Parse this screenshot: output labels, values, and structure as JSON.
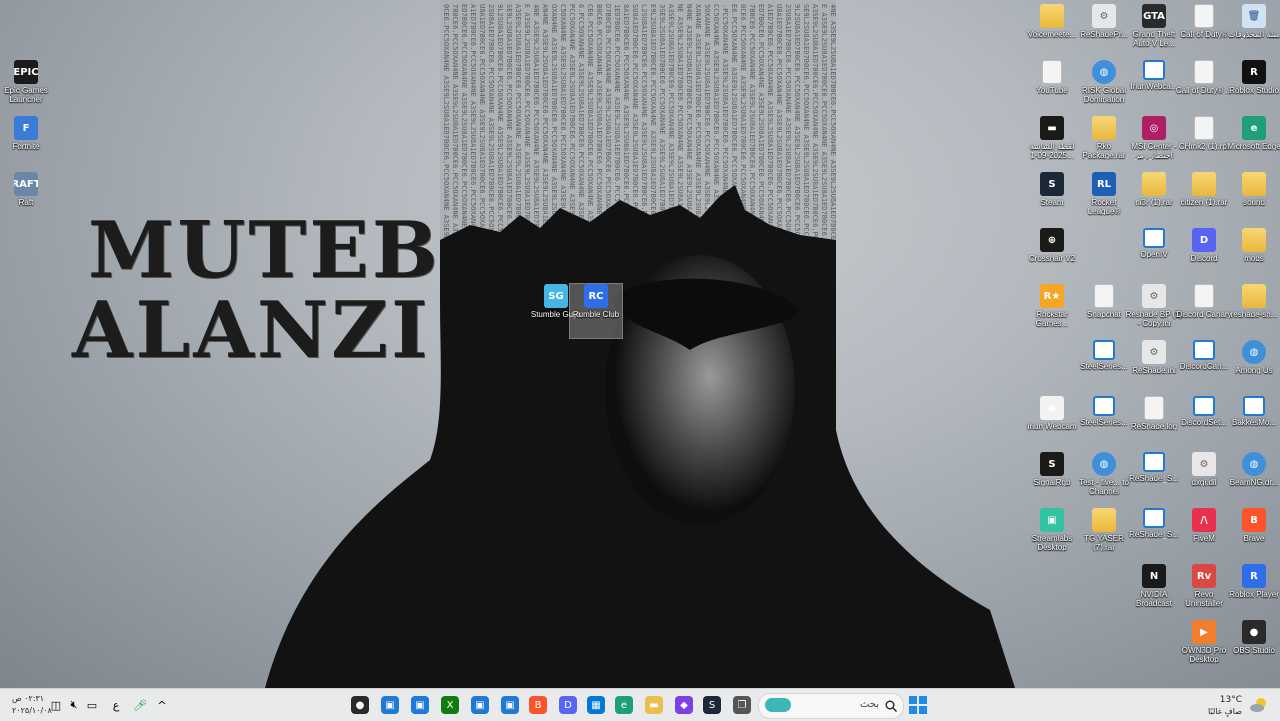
{
  "wallpaper": {
    "line1": "MUTEB",
    "line2": "ALANZI"
  },
  "desktop_icons": [
    {
      "label": "Voicemeete...",
      "kind": "folder",
      "color": "#e9bf4f"
    },
    {
      "label": "ReShadePr...",
      "kind": "gear",
      "color": "#8a8f96"
    },
    {
      "label": "Grand Theft Auto V Le...",
      "kind": "app",
      "color": "#2b2b2b",
      "text": "GTA"
    },
    {
      "label": "Call of Duty®",
      "kind": "file",
      "color": "#ffffff"
    },
    {
      "label": "سلة المحذوفات",
      "kind": "bin",
      "color": "#cfe3f5"
    },
    {
      "label": "Epic Games Launcher",
      "kind": "app",
      "color": "#1b1b1b",
      "text": "EPIC"
    },
    {
      "label": "YouTube",
      "kind": "file",
      "color": "#ffffff"
    },
    {
      "label": "RISK Global Domination",
      "kind": "globe",
      "color": "#3f8fd9"
    },
    {
      "label": "IriunWebca...",
      "kind": "box",
      "color": "#1f7ad6"
    },
    {
      "label": "Call of Duty® ...",
      "kind": "file",
      "color": "#ffffff"
    },
    {
      "label": "Roblox Studio",
      "kind": "app",
      "color": "#111111",
      "text": "R"
    },
    {
      "label": "Fortnite",
      "kind": "app",
      "color": "#3a7bd5",
      "text": "F"
    },
    {
      "label": "لقطة الشاشة 2025-09-1...",
      "kind": "app",
      "color": "#1a1a1a",
      "text": "▬"
    },
    {
      "label": "Rko Package.rar",
      "kind": "folder",
      "color": "#e9bf4f"
    },
    {
      "label": "MSI Center - اختصار رمز",
      "kind": "app",
      "color": "#b01e63",
      "text": "◎"
    },
    {
      "label": "CHmk2 (1).rpf",
      "kind": "file",
      "color": "#ffffff"
    },
    {
      "label": "Microsoft Edge",
      "kind": "app",
      "color": "#1f9e7a",
      "text": "e"
    },
    {
      "label": "Raft",
      "kind": "app",
      "color": "#6a87a8",
      "text": "RAFT"
    },
    {
      "label": "Steam",
      "kind": "app",
      "color": "#1b2838",
      "text": "S"
    },
    {
      "label": "Rocket League®",
      "kind": "app",
      "color": "#1d5fb4",
      "text": "RL"
    },
    {
      "label": "ni3r (1).rar",
      "kind": "folder",
      "color": "#e9bf4f"
    },
    {
      "label": "citizen (1).rar",
      "kind": "folder",
      "color": "#e9bf4f"
    },
    {
      "label": "sound",
      "kind": "folder",
      "color": "#e9bf4f"
    },
    {
      "label": "Crosshair V2",
      "kind": "app",
      "color": "#1a1a1a",
      "text": "⊕"
    },
    {
      "label": "OpenIV",
      "kind": "box",
      "color": "#1f7ad6"
    },
    {
      "label": "Discord",
      "kind": "app",
      "color": "#5865f2",
      "text": "D"
    },
    {
      "label": "mods",
      "kind": "folder",
      "color": "#e9bf4f"
    },
    {
      "label": "Rockstar Games...",
      "kind": "app",
      "color": "#f5a623",
      "text": "R★"
    },
    {
      "label": "Snapchat",
      "kind": "file",
      "color": "#ffffff"
    },
    {
      "label": "Reshade BP (1) - Copy.ini",
      "kind": "gear",
      "color": "#8a8f96"
    },
    {
      "label": "Discord Canary",
      "kind": "file",
      "color": "#ffffff"
    },
    {
      "label": "reshade-sh...",
      "kind": "folder",
      "color": "#e9bf4f"
    },
    {
      "label": "SteelSeries...",
      "kind": "box",
      "color": "#1f7ad6"
    },
    {
      "label": "ReShade.ini",
      "kind": "gear",
      "color": "#8a8f96"
    },
    {
      "label": "DiscordCan...",
      "kind": "box",
      "color": "#1f7ad6"
    },
    {
      "label": "Among Us",
      "kind": "globe",
      "color": "#3f8fd9"
    },
    {
      "label": "Iriun Webcam",
      "kind": "app",
      "color": "#f2f2f2",
      "text": "◉"
    },
    {
      "label": "SteelSeries...",
      "kind": "box",
      "color": "#1f7ad6"
    },
    {
      "label": "ReShade.log",
      "kind": "file",
      "color": "#ffffff"
    },
    {
      "label": "DiscordSet...",
      "kind": "box",
      "color": "#1f7ad6"
    },
    {
      "label": "BakkesMo...",
      "kind": "box",
      "color": "#1f7ad6"
    },
    {
      "label": "SignalRgb",
      "kind": "app",
      "color": "#1a1a1a",
      "text": "S"
    },
    {
      "label": "Test - five... to Channel",
      "kind": "globe",
      "color": "#3f8fd9"
    },
    {
      "label": "ReShade_S...",
      "kind": "box",
      "color": "#1f7ad6"
    },
    {
      "label": "dxgi.dll",
      "kind": "gear",
      "color": "#8a8f96"
    },
    {
      "label": "BeamNG.dr...",
      "kind": "globe",
      "color": "#3f8fd9"
    },
    {
      "label": "Streamlabs Desktop",
      "kind": "app",
      "color": "#31c3a2",
      "text": "▣"
    },
    {
      "label": "TG YASER (7).rar",
      "kind": "folder",
      "color": "#e9bf4f"
    },
    {
      "label": "ReShade_S...",
      "kind": "box",
      "color": "#1f7ad6"
    },
    {
      "label": "FiveM",
      "kind": "app",
      "color": "#e8304f",
      "text": "/\\"
    },
    {
      "label": "Brave",
      "kind": "app",
      "color": "#fb542b",
      "text": "B"
    },
    {
      "label": "NVIDIA Broadcast",
      "kind": "app",
      "color": "#1a1a1a",
      "text": "N"
    },
    {
      "label": "Revo Uninstaller",
      "kind": "app",
      "color": "#d94841",
      "text": "Rv"
    },
    {
      "label": "Roblox Player",
      "kind": "app",
      "color": "#2f6ee8",
      "text": "R"
    },
    {
      "label": "OWN3D Pro Desktop",
      "kind": "app",
      "color": "#f07e2a",
      "text": "▶"
    },
    {
      "label": "OBS Studio",
      "kind": "app",
      "color": "#2a2a2a",
      "text": "●"
    },
    {
      "label": "Stumble Guys",
      "kind": "app",
      "color": "#45b6e8",
      "text": "SG"
    },
    {
      "label": "Rumble Club",
      "kind": "app",
      "color": "#2f6ee8",
      "text": "RC"
    }
  ],
  "taskbar": {
    "search_placeholder": "بحث",
    "weather_temp": "13°C",
    "weather_desc": "صافٍ غالبًا",
    "clock_time": "٠٢:٣١ ص",
    "clock_date": "٢٠٢٥/١٠/٠٨",
    "lang": "ع",
    "items": [
      {
        "name": "obs-taskbar-icon",
        "color": "#2a2a2a",
        "text": "●"
      },
      {
        "name": "window-taskbar-icon-1",
        "color": "#1f7ad6",
        "text": "▣"
      },
      {
        "name": "window-taskbar-icon-2",
        "color": "#1f7ad6",
        "text": "▣"
      },
      {
        "name": "xbox-taskbar-icon",
        "color": "#107c10",
        "text": "X"
      },
      {
        "name": "window-taskbar-icon-3",
        "color": "#1f7ad6",
        "text": "▣"
      },
      {
        "name": "window-taskbar-icon-4",
        "color": "#1f7ad6",
        "text": "▣"
      },
      {
        "name": "brave-taskbar-icon",
        "color": "#fb542b",
        "text": "B"
      },
      {
        "name": "discord-taskbar-icon",
        "color": "#5865f2",
        "text": "D"
      },
      {
        "name": "store-taskbar-icon",
        "color": "#0078d4",
        "text": "▦"
      },
      {
        "name": "edge-taskbar-icon",
        "color": "#1f9e7a",
        "text": "e"
      },
      {
        "name": "explorer-taskbar-icon",
        "color": "#e9bf4f",
        "text": "▬"
      },
      {
        "name": "hub-taskbar-icon",
        "color": "#7b3fe4",
        "text": "◆"
      },
      {
        "name": "steam-taskbar-icon",
        "color": "#1b2838",
        "text": "S"
      },
      {
        "name": "desktops-taskbar-icon",
        "color": "#555555",
        "text": "❐"
      }
    ]
  }
}
